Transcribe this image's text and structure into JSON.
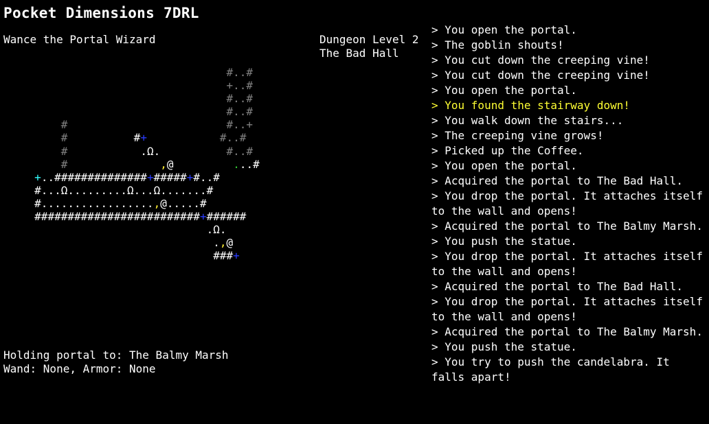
{
  "game_title": "Pocket Dimensions 7DRL",
  "player": {
    "name_line": "Wance the Portal Wizard",
    "holding_line": "Holding portal to: The Balmy Marsh",
    "equipment_line": "Wand: None, Armor: None"
  },
  "level": {
    "depth_line": "Dungeon Level 2",
    "name_line": "The Bad Hall"
  },
  "message_log": [
    "> You open the portal.",
    "> The goblin shouts!",
    "> You cut down the creeping vine!",
    "> You cut down the creeping vine!",
    "> You open the portal.",
    "> You found the stairway down!",
    "> You walk down the stairs...",
    "> The creeping vine grows!",
    "> Picked up the Coffee.",
    "> You open the portal.",
    "> Acquired the portal to The Bad Hall.",
    "> You drop the portal. It attaches itself to the wall and opens!",
    "> Acquired the portal to The Balmy Marsh.",
    "> You push the statue.",
    "> You drop the portal. It attaches itself to the wall and opens!",
    "> Acquired the portal to The Bad Hall.",
    "> You drop the portal. It attaches itself to the wall and opens!",
    "> Acquired the portal to The Balmy Marsh.",
    "> You push the statue.",
    "> You try to push the candelabra. It falls apart!"
  ],
  "highlighted_message_index": 5,
  "map_rows": [
    [
      [
        "                                  ",
        "w"
      ],
      [
        "#..#",
        "g"
      ]
    ],
    [
      [
        "                                  ",
        "w"
      ],
      [
        "+..#",
        "g"
      ]
    ],
    [
      [
        "                                  ",
        "w"
      ],
      [
        "#..#",
        "g"
      ]
    ],
    [
      [
        "                                  ",
        "w"
      ],
      [
        "#..#",
        "g"
      ]
    ],
    [
      [
        "         ",
        "w"
      ],
      [
        "#",
        "g"
      ],
      [
        "                        ",
        "w"
      ],
      [
        "#..+",
        "g"
      ]
    ],
    [
      [
        "         ",
        "w"
      ],
      [
        "#",
        "g"
      ],
      [
        "          ",
        "w"
      ],
      [
        "#",
        "w"
      ],
      [
        "+",
        "b"
      ],
      [
        "           ",
        "w"
      ],
      [
        "#..#",
        "g"
      ]
    ],
    [
      [
        "         ",
        "w"
      ],
      [
        "#",
        "g"
      ],
      [
        "           ",
        "w"
      ],
      [
        ".Ω.",
        "w"
      ],
      [
        "          ",
        "w"
      ],
      [
        "#..#",
        "g"
      ]
    ],
    [
      [
        "         ",
        "w"
      ],
      [
        "#",
        "g"
      ],
      [
        "              ",
        "w"
      ],
      [
        ",",
        "y"
      ],
      [
        "@",
        "w"
      ],
      [
        "         ",
        "w"
      ],
      [
        ".",
        "gr"
      ],
      [
        "..#",
        "w"
      ]
    ],
    [
      [
        "     ",
        "w"
      ],
      [
        "+",
        "c"
      ],
      [
        "..##############",
        "w"
      ],
      [
        "+",
        "b"
      ],
      [
        "#####",
        "w"
      ],
      [
        "+",
        "b"
      ],
      [
        "#..#",
        "w"
      ]
    ],
    [
      [
        "     ",
        "w"
      ],
      [
        "#...Ω.........Ω...Ω.......#",
        "w"
      ]
    ],
    [
      [
        "     ",
        "w"
      ],
      [
        "#.................",
        "w"
      ],
      [
        ",",
        "y"
      ],
      [
        "@",
        "w"
      ],
      [
        ".....#",
        "w"
      ]
    ],
    [
      [
        "     ",
        "w"
      ],
      [
        "#########################",
        "w"
      ],
      [
        "+",
        "b"
      ],
      [
        "######",
        "w"
      ]
    ],
    [
      [
        "                               ",
        "w"
      ],
      [
        ".Ω.",
        "w"
      ]
    ],
    [
      [
        "                                ",
        "w"
      ],
      [
        ".",
        "w"
      ],
      [
        ",",
        "y"
      ],
      [
        "@",
        "w"
      ]
    ],
    [
      [
        "                                ",
        "w"
      ],
      [
        "###",
        "w"
      ],
      [
        "+",
        "b"
      ]
    ]
  ]
}
